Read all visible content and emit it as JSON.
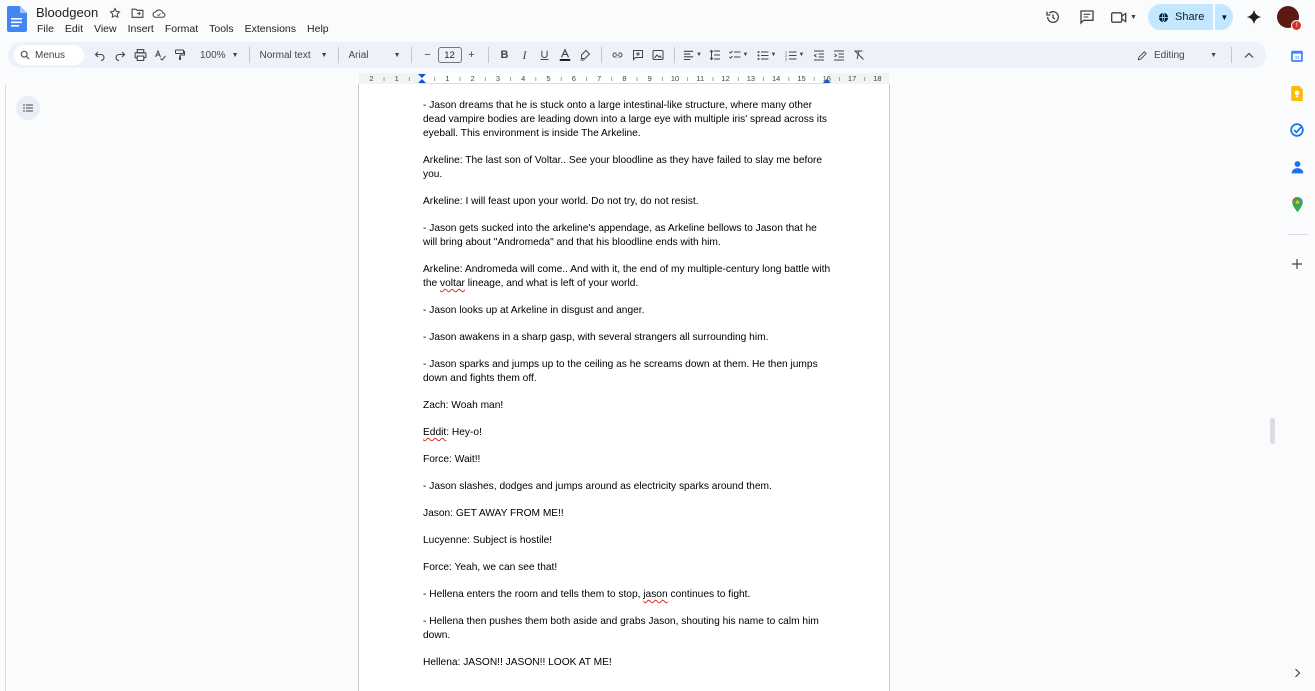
{
  "app": {
    "title": "Bloodgeon",
    "menu": [
      "File",
      "Edit",
      "View",
      "Insert",
      "Format",
      "Tools",
      "Extensions",
      "Help"
    ],
    "share_label": "Share"
  },
  "toolbar": {
    "search_placeholder": "Menus",
    "zoom": "100%",
    "style": "Normal text",
    "font": "Arial",
    "font_size": "12",
    "mode": "Editing"
  },
  "ruler": {
    "labels": [
      "2",
      "1",
      "1",
      "2",
      "3",
      "4",
      "5",
      "6",
      "7",
      "8",
      "9",
      "10",
      "11",
      "12",
      "13",
      "14",
      "15",
      "16",
      "17",
      "18"
    ]
  },
  "document": {
    "paragraphs": [
      {
        "segments": [
          {
            "text": "- Jason dreams that he is stuck onto a large intestinal-like structure, where many other dead vampire bodies are leading down into a large eye with multiple iris' spread across its eyeball. This environment is inside The Arkeline."
          }
        ]
      },
      {
        "segments": [
          {
            "text": "Arkeline: The last son of Voltar.. See your bloodline as they have failed to slay me before you."
          }
        ]
      },
      {
        "segments": [
          {
            "text": "Arkeline: I will feast upon your world. Do not try, do not resist."
          }
        ]
      },
      {
        "segments": [
          {
            "text": "- Jason gets sucked into the arkeline's appendage, as Arkeline bellows to Jason that he will bring about \"Andromeda\" and that his bloodline ends with him."
          }
        ]
      },
      {
        "segments": [
          {
            "text": "Arkeline: Andromeda will come.. And with it, the end of my multiple-century long battle with the "
          },
          {
            "text": "voltar",
            "squig": true
          },
          {
            "text": " lineage, and what is left of your world."
          }
        ]
      },
      {
        "segments": [
          {
            "text": "- Jason looks up at Arkeline in disgust and anger."
          }
        ]
      },
      {
        "segments": [
          {
            "text": "- Jason awakens in a sharp gasp, with several strangers all surrounding him."
          }
        ]
      },
      {
        "segments": [
          {
            "text": "- Jason sparks and jumps up to the ceiling as he screams down at them. He then jumps down and fights them off."
          }
        ]
      },
      {
        "segments": [
          {
            "text": "Zach: Woah man!"
          }
        ]
      },
      {
        "segments": [
          {
            "text": "Eddit",
            "squig": true
          },
          {
            "text": ": Hey-o!"
          }
        ]
      },
      {
        "segments": [
          {
            "text": "Force: Wait!!"
          }
        ]
      },
      {
        "segments": [
          {
            "text": "- Jason slashes, dodges and jumps around as electricity sparks around them."
          }
        ]
      },
      {
        "segments": [
          {
            "text": "Jason: GET AWAY FROM ME!!"
          }
        ]
      },
      {
        "segments": [
          {
            "text": "Lucyenne: Subject is hostile!"
          }
        ]
      },
      {
        "segments": [
          {
            "text": "Force: Yeah, we can see that!"
          }
        ]
      },
      {
        "segments": [
          {
            "text": "- Hellena enters the room and tells them to stop, "
          },
          {
            "text": "jason",
            "squig": true
          },
          {
            "text": " continues to fight."
          }
        ]
      },
      {
        "segments": [
          {
            "text": "- Hellena then pushes them both aside and grabs Jason, shouting his name to calm him down."
          }
        ]
      },
      {
        "segments": [
          {
            "text": "Hellena: JASON!! JASON!! LOOK AT ME!"
          }
        ]
      }
    ]
  },
  "colors": {
    "accent": "#0b57d0",
    "share_bg": "#c2e7ff",
    "toolbar_bg": "#edf2fa",
    "spell_error": "#d93025"
  }
}
